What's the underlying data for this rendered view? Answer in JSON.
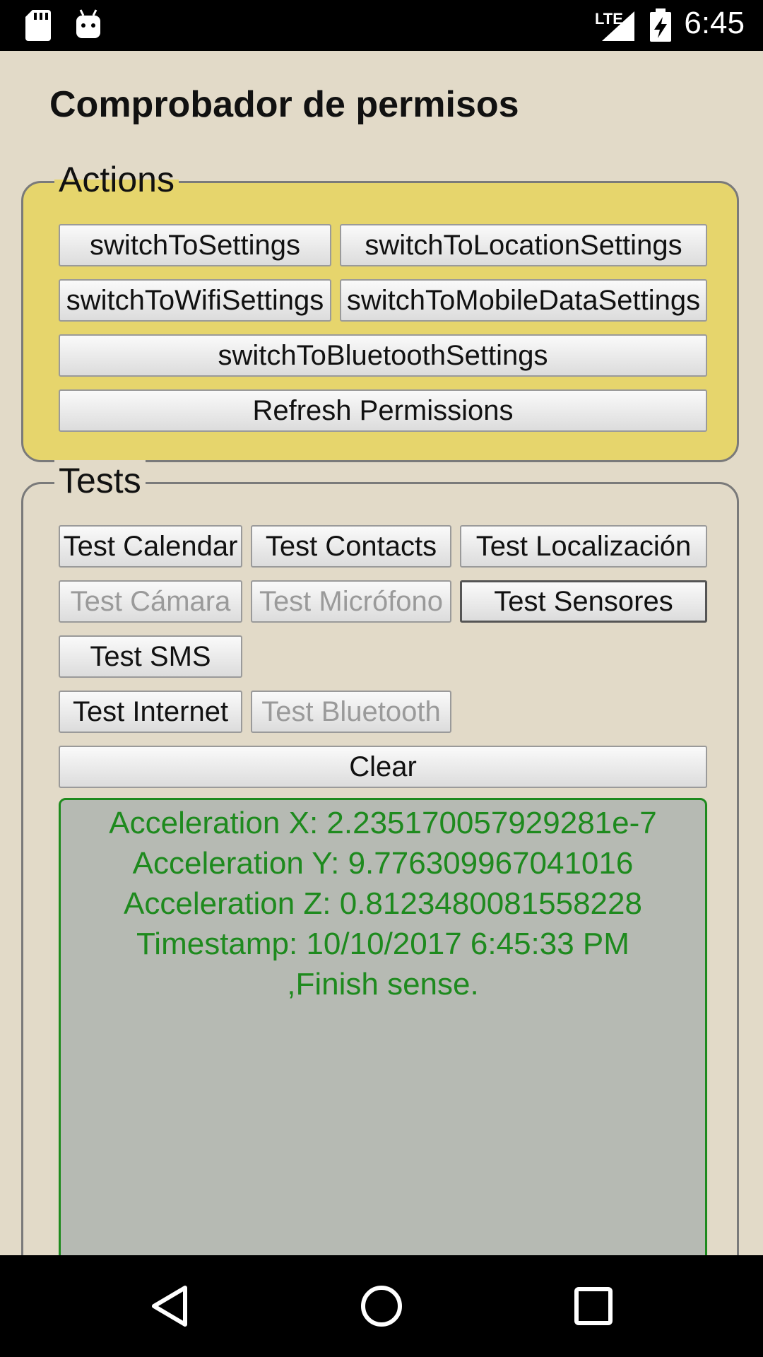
{
  "status_bar": {
    "time": "6:45",
    "network_label": "LTE",
    "icons": [
      "sd-card-icon",
      "android-icon",
      "signal-icon",
      "battery-charging-icon"
    ]
  },
  "app": {
    "title": "Comprobador de permisos"
  },
  "actions": {
    "legend": "Actions",
    "buttons": {
      "settings": "switchToSettings",
      "location": "switchToLocationSettings",
      "wifi": "switchToWifiSettings",
      "mobile_data": "switchToMobileDataSettings",
      "bluetooth": "switchToBluetoothSettings",
      "refresh": "Refresh Permissions"
    }
  },
  "tests": {
    "legend": "Tests",
    "buttons": {
      "calendar": "Test Calendar",
      "contacts": "Test Contacts",
      "location": "Test Localización",
      "camera": "Test Cámara",
      "microphone": "Test Micrófono",
      "sensors": "Test Sensores",
      "sms": "Test SMS",
      "internet": "Test Internet",
      "bluetooth": "Test Bluetooth",
      "clear": "Clear"
    },
    "output_lines": [
      "Acceleration X: 2.235170057929281e-7",
      "Acceleration Y: 9.776309967041016",
      "Acceleration Z: 0.8123480081558228",
      "Timestamp: 10/10/2017 6:45:33 PM",
      ",Finish sense."
    ]
  },
  "colors": {
    "background": "#e2dac8",
    "actions_panel": "#e6d56c",
    "output_panel": "#b6bab3",
    "output_text": "#1e8a1e"
  },
  "nav_bar": {
    "icons": [
      "back-icon",
      "home-icon",
      "recents-icon"
    ]
  }
}
